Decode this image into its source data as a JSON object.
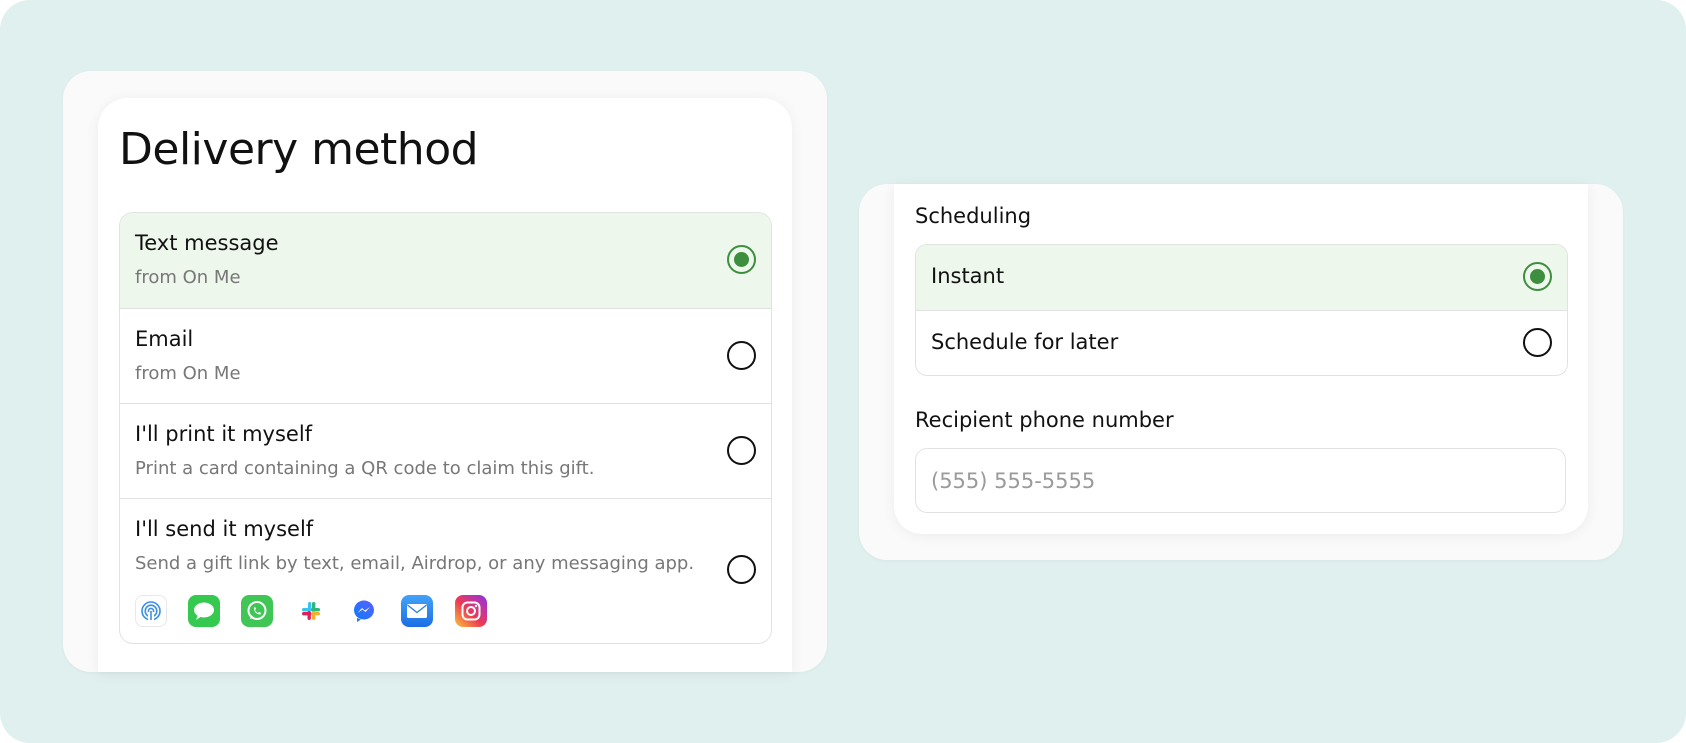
{
  "delivery": {
    "title": "Delivery method",
    "options": [
      {
        "label": "Text message",
        "sub": "from On Me",
        "selected": true
      },
      {
        "label": "Email",
        "sub": "from On Me",
        "selected": false
      },
      {
        "label": "I'll print it myself",
        "sub": "Print a card containing a QR code to claim this gift.",
        "selected": false
      },
      {
        "label": "I'll send it myself",
        "sub": "Send a gift link by text, email, Airdrop, or any messaging app.",
        "selected": false
      }
    ],
    "share_apps": [
      "airdrop-icon",
      "messages-icon",
      "whatsapp-icon",
      "slack-icon",
      "messenger-icon",
      "mail-icon",
      "instagram-icon"
    ]
  },
  "scheduling": {
    "label": "Scheduling",
    "options": [
      {
        "label": "Instant",
        "selected": true
      },
      {
        "label": "Schedule for later",
        "selected": false
      }
    ]
  },
  "recipient": {
    "label": "Recipient phone number",
    "placeholder": "(555) 555-5555",
    "value": ""
  },
  "colors": {
    "background": "#dff0ef",
    "selected_row": "#eef7ec",
    "accent": "#3e8e3f"
  }
}
